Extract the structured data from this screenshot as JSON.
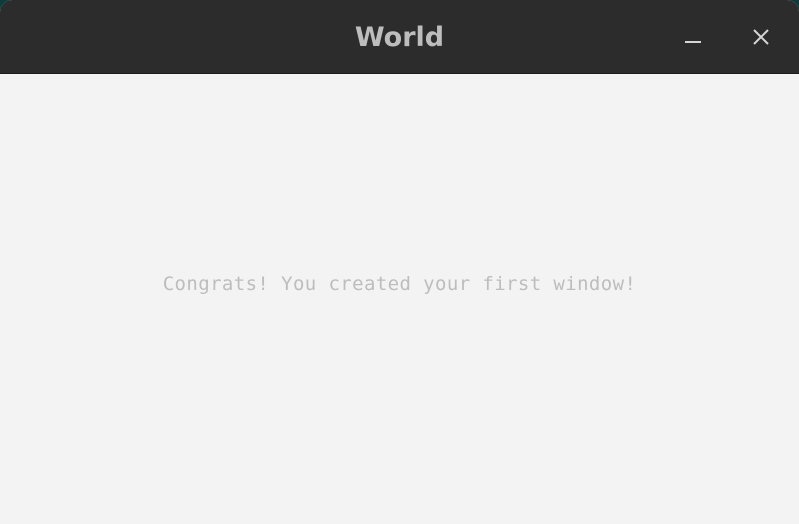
{
  "window": {
    "title": "World"
  },
  "titlebar_buttons": {
    "minimize_icon": "minimize-icon",
    "close_icon": "close-icon"
  },
  "content": {
    "message": "Congrats! You created your first window!"
  },
  "colors": {
    "titlebar_bg": "#2c2c2c",
    "title_text": "#bdbdbd",
    "content_bg": "#f3f3f3",
    "message_text": "#bdbdbd"
  }
}
